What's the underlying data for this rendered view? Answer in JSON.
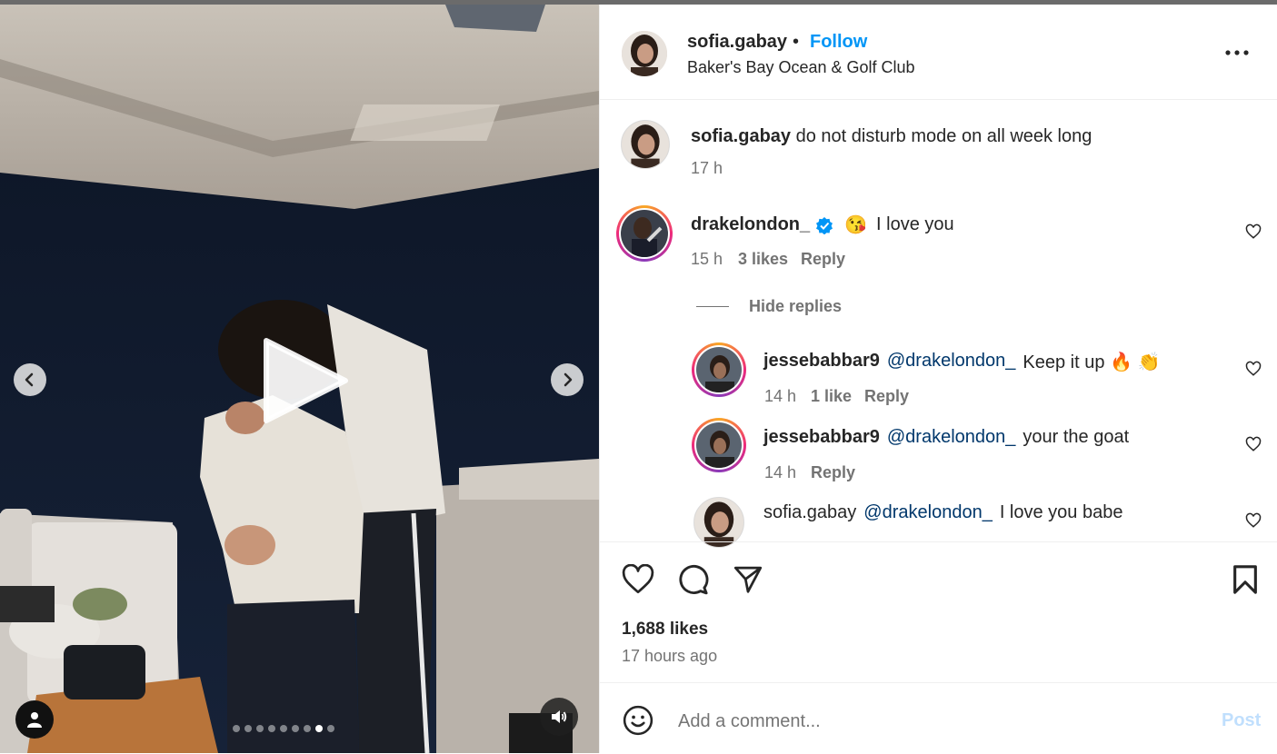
{
  "post": {
    "username": "sofia.gabay",
    "separator": "•",
    "follow_label": "Follow",
    "location": "Baker's Bay Ocean & Golf Club",
    "more_icon": "more-horizontal-icon",
    "media": {
      "carousel_count": 9,
      "carousel_active_index": 7,
      "play_icon": "play-icon",
      "prev_icon": "chevron-left-icon",
      "next_icon": "chevron-right-icon",
      "tag_icon": "user-tag-icon",
      "sound_icon": "speaker-icon"
    }
  },
  "caption": {
    "username": "sofia.gabay",
    "text": "do not disturb mode on all week long",
    "time": "17 h"
  },
  "comments": [
    {
      "username": "drakelondon_",
      "verified": true,
      "emoji": "😘",
      "text": "I love you",
      "time": "15 h",
      "likes": "3 likes",
      "reply_label": "Reply",
      "hide_replies_label": "Hide replies",
      "replies": [
        {
          "username": "jessebabbar9",
          "mention": "@drakelondon_",
          "text": "Keep it up 🔥 👏",
          "time": "14 h",
          "likes": "1 like",
          "reply_label": "Reply"
        },
        {
          "username": "jessebabbar9",
          "mention": "@drakelondon_",
          "text": "your the goat",
          "time": "14 h",
          "reply_label": "Reply"
        },
        {
          "username": "sofia.gabay",
          "mention": "@drakelondon_",
          "text": "I love you babe"
        }
      ]
    }
  ],
  "actions": {
    "likes": "1,688 likes",
    "time_ago": "17 hours ago"
  },
  "add_comment": {
    "placeholder": "Add a comment...",
    "post_label": "Post"
  },
  "colors": {
    "accent": "#0095f6",
    "verified": "#0095f6",
    "post_disabled": "#c0dffd"
  }
}
